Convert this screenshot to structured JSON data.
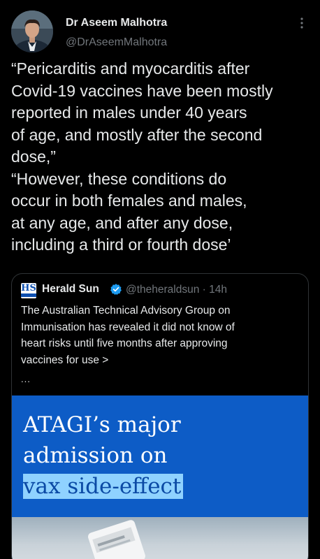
{
  "author": {
    "name": "Dr Aseem Malhotra",
    "handle": "@DrAseemMalhotra",
    "avatar_icon": "profile-photo"
  },
  "tweet": {
    "lines": [
      "“Pericarditis and myocarditis after",
      "Covid-19 vaccines have been mostly",
      "reported in males under 40 years",
      "of age, and mostly after the second",
      "dose,”",
      "“However, these conditions do",
      "occur in both females and males,",
      "at any age, and after any dose,",
      "including a third or fourth dose’"
    ]
  },
  "quote": {
    "logo_text": "HS",
    "name": "Herald Sun",
    "handle_time": "@theheraldsun · 14h",
    "text_lines": [
      "The Australian Technical Advisory Group on",
      "Immunisation has revealed it did not know of",
      "heart risks until five months after approving",
      "vaccines for use >"
    ],
    "ellipsis": "...",
    "image": {
      "headline_lines": [
        "ATAGI’s major",
        "admission on"
      ],
      "highlighted_line": "vax side-effect",
      "background_color": "#0d5cc6",
      "highlight_color": "#8fd2ff"
    }
  },
  "colors": {
    "background": "#000000",
    "text": "#e7e9ea",
    "secondary_text": "#71767b",
    "verified": "#1d9bf0",
    "border": "#2f3336"
  }
}
